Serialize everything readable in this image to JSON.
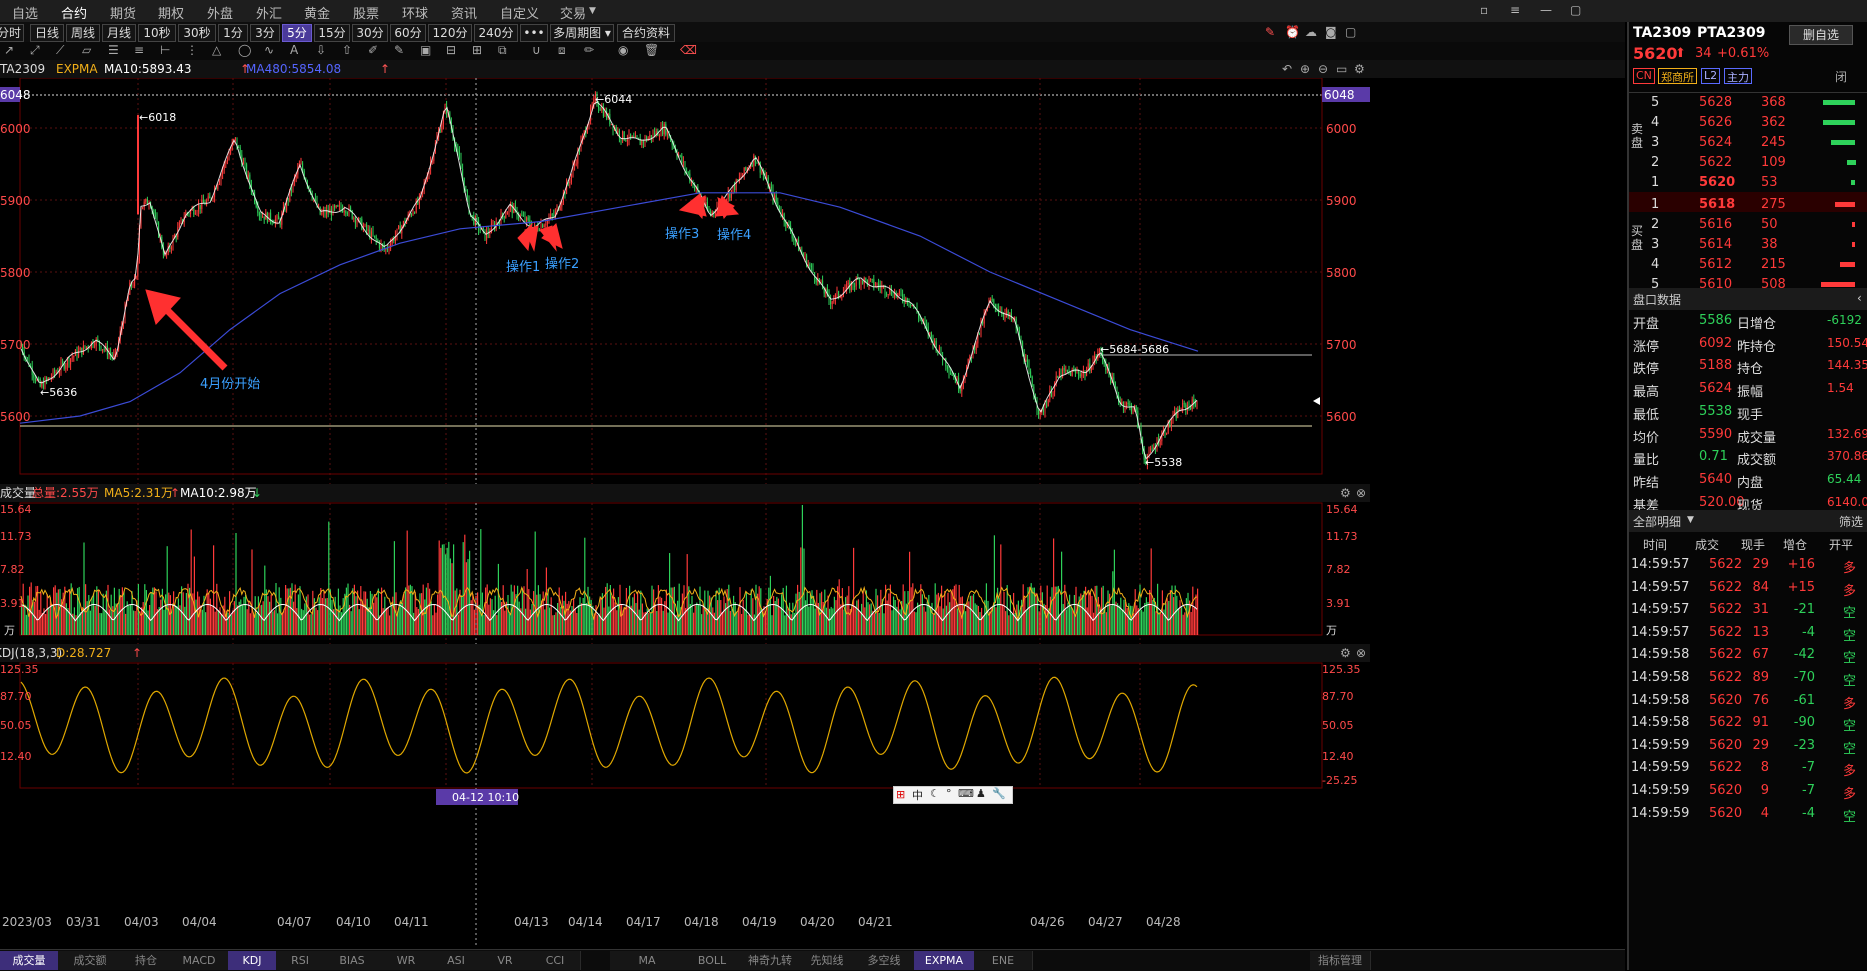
{
  "top_nav": {
    "items": [
      "自选",
      "合约",
      "期货",
      "期权",
      "外盘",
      "外汇",
      "黄金",
      "股票",
      "环球",
      "资讯",
      "自定义",
      "交易"
    ],
    "active": "合约",
    "window_controls": [
      "minimize-icon",
      "restore-icon",
      "close-icon"
    ]
  },
  "period_bar": {
    "buttons": [
      "分时",
      "日线",
      "周线",
      "月线",
      "10秒",
      "30秒",
      "1分",
      "3分",
      "5分",
      "15分",
      "30分",
      "60分",
      "120分",
      "240分",
      "•••",
      "多周期图",
      "合约资料"
    ],
    "selected": "5分"
  },
  "legend": {
    "symbol": "TA2309",
    "indicator": "EXPMA",
    "ma10": "MA10:5893.43",
    "ma480": "MA480:5854.08"
  },
  "price_axis": {
    "left_labels": [
      "6048",
      "6000",
      "5900",
      "5800",
      "5700",
      "5600"
    ],
    "right_labels": [
      "6048",
      "6000",
      "5900",
      "5800",
      "5700",
      "5600"
    ]
  },
  "annotations": {
    "high1": "6018",
    "high2": "6044",
    "low1": "5636",
    "low2": "5538",
    "range": "5684-5686",
    "april_start": "4月份开始",
    "op1": "操作1",
    "op2": "操作2",
    "op3": "操作3",
    "op4": "操作4"
  },
  "volume_panel": {
    "title": "成交量",
    "total": "总量:2.55万",
    "ma5": "MA5:2.31万",
    "ma10": "MA10:2.98万",
    "left_labels": [
      "15.64",
      "11.73",
      "7.82",
      "3.91",
      "万"
    ],
    "right_labels": [
      "15.64",
      "11.73",
      "7.82",
      "3.91",
      "万"
    ]
  },
  "kdj_panel": {
    "title": "KDJ(18,3,3)",
    "d_value": "D:28.727",
    "left_labels": [
      "125.35",
      "87.70",
      "50.05",
      "12.40"
    ],
    "right_labels": [
      "125.35",
      "87.70",
      "50.05",
      "12.40",
      "-25.25"
    ]
  },
  "x_axis": {
    "labels": [
      "2023/03",
      "03/31",
      "04/03",
      "04/04",
      "04/07",
      "04/10",
      "04/11",
      "04/13",
      "04/14",
      "04/17",
      "04/18",
      "04/19",
      "04/20",
      "04/21",
      "04/26",
      "04/27",
      "04/28"
    ],
    "crosshair": "04-12 10:10"
  },
  "ime_bar": "中",
  "bottom_tabs": [
    "成交量",
    "成交额",
    "持仓",
    "MACD",
    "KDJ",
    "RSI",
    "BIAS",
    "WR",
    "ASI",
    "VR",
    "CCI",
    "MA",
    "BOLL",
    "神奇九转",
    "先知线",
    "多空线",
    "EXPMA",
    "ENE",
    "指标管理"
  ],
  "bottom_tab_selected": [
    "成交量",
    "KDJ",
    "EXPMA"
  ],
  "right_panel": {
    "code": "TA2309",
    "name": "PTA2309",
    "menu_button": "删自选",
    "price": "5620",
    "change": "34",
    "change_pct": "+0.61%",
    "badges": [
      "CN",
      "郑商所",
      "L2",
      "主力"
    ],
    "ask_label": "卖盘",
    "bid_label": "买盘",
    "asks": [
      {
        "level": "5",
        "price": "5628",
        "vol": "368",
        "bar": 0.95
      },
      {
        "level": "4",
        "price": "5626",
        "vol": "362",
        "bar": 0.93
      },
      {
        "level": "3",
        "price": "5624",
        "vol": "245",
        "bar": 0.7
      },
      {
        "level": "2",
        "price": "5622",
        "vol": "109",
        "bar": 0.25
      },
      {
        "level": "1",
        "price": "5620",
        "vol": "53",
        "bar": 0.12
      }
    ],
    "bids": [
      {
        "level": "1",
        "price": "5618",
        "vol": "275",
        "bar": 0.6
      },
      {
        "level": "2",
        "price": "5616",
        "vol": "50",
        "bar": 0.1
      },
      {
        "level": "3",
        "price": "5614",
        "vol": "38",
        "bar": 0.08
      },
      {
        "level": "4",
        "price": "5612",
        "vol": "215",
        "bar": 0.45
      },
      {
        "level": "5",
        "price": "5610",
        "vol": "508",
        "bar": 1.0
      }
    ],
    "pankou_title": "盘口数据",
    "stats": [
      {
        "l": "开盘",
        "v": "5586",
        "l2": "日增仓",
        "v2": "-6192"
      },
      {
        "l": "涨停",
        "v": "6092",
        "l2": "昨持仓",
        "v2": "150.54"
      },
      {
        "l": "跌停",
        "v": "5188",
        "l2": "持仓",
        "v2": "144.35"
      },
      {
        "l": "最高",
        "v": "5624",
        "l2": "振幅",
        "v2": "1.54"
      },
      {
        "l": "最低",
        "v": "5538",
        "l2": "现手",
        "v2": ""
      },
      {
        "l": "均价",
        "v": "5590",
        "l2": "成交量",
        "v2": "132.69"
      },
      {
        "l": "量比",
        "v": "0.71",
        "l2": "成交额",
        "v2": "370.86"
      },
      {
        "l": "昨结",
        "v": "5640",
        "l2": "内盘",
        "v2": "65.44"
      },
      {
        "l": "基差",
        "v": "520.00",
        "l2": "现货",
        "v2": "6140.0"
      }
    ],
    "detail_title": "全部明细",
    "filter": "筛选",
    "detail_headers": [
      "时间",
      "成交",
      "现手",
      "增仓",
      "开平"
    ],
    "ticks": [
      {
        "t": "14:59:57",
        "p": "5622",
        "v": "29",
        "c": "+16",
        "d": "多"
      },
      {
        "t": "14:59:57",
        "p": "5622",
        "v": "84",
        "c": "+15",
        "d": "多"
      },
      {
        "t": "14:59:57",
        "p": "5622",
        "v": "31",
        "c": "-21",
        "d": "空"
      },
      {
        "t": "14:59:57",
        "p": "5622",
        "v": "13",
        "c": "-4",
        "d": "空"
      },
      {
        "t": "14:59:58",
        "p": "5622",
        "v": "67",
        "c": "-42",
        "d": "空"
      },
      {
        "t": "14:59:58",
        "p": "5622",
        "v": "89",
        "c": "-70",
        "d": "空"
      },
      {
        "t": "14:59:58",
        "p": "5620",
        "v": "76",
        "c": "-61",
        "d": "多"
      },
      {
        "t": "14:59:58",
        "p": "5622",
        "v": "91",
        "c": "-90",
        "d": "空"
      },
      {
        "t": "14:59:59",
        "p": "5620",
        "v": "29",
        "c": "-23",
        "d": "空"
      },
      {
        "t": "14:59:59",
        "p": "5622",
        "v": "8",
        "c": "-7",
        "d": "多"
      },
      {
        "t": "14:59:59",
        "p": "5620",
        "v": "9",
        "c": "-7",
        "d": "多"
      },
      {
        "t": "14:59:59",
        "p": "5620",
        "v": "4",
        "c": "-4",
        "d": "空"
      }
    ]
  },
  "colors": {
    "up": "#ff3a3a",
    "down": "#2ed15a",
    "ma480": "#3b4bd6",
    "kdj": "#e0a800",
    "vol_ma5": "#f2b019",
    "vol_ma10": "#ffffff",
    "accent": "#4a3a9a"
  }
}
